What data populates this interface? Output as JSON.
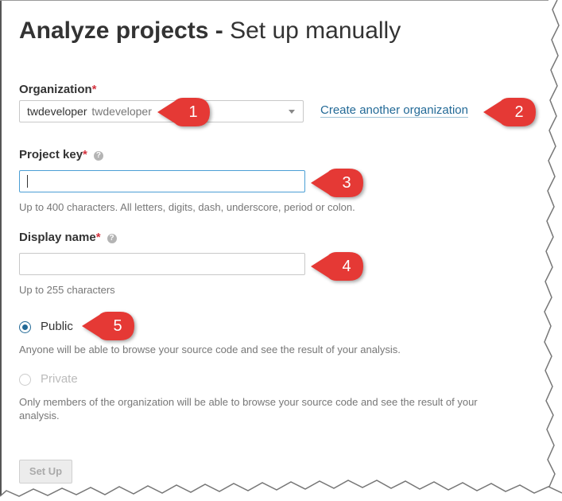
{
  "page": {
    "title_strong": "Analyze projects",
    "title_sep": " - ",
    "title_rest": "Set up manually"
  },
  "organization": {
    "label": "Organization",
    "required_mark": "*",
    "selected_key": "twdeveloper",
    "selected_name": "twdeveloper",
    "create_link": "Create another organization"
  },
  "project_key": {
    "label": "Project key",
    "required_mark": "*",
    "help_icon": "?",
    "value": "",
    "hint": "Up to 400 characters. All letters, digits, dash, underscore, period or colon."
  },
  "display_name": {
    "label": "Display name",
    "required_mark": "*",
    "help_icon": "?",
    "value": "",
    "hint": "Up to 255 characters"
  },
  "visibility": {
    "public_label": "Public",
    "public_desc": "Anyone will be able to browse your source code and see the result of your analysis.",
    "private_label": "Private",
    "private_desc_line1": "Only members of the organization will be able to browse your source code and see the result of your",
    "private_desc_line2": "analysis.",
    "selected": "public"
  },
  "actions": {
    "setup_label": "Set Up"
  },
  "callouts": [
    "1",
    "2",
    "3",
    "4",
    "5"
  ],
  "colors": {
    "accent": "#236a97",
    "required": "#d4333f",
    "callout": "#e53935",
    "focus": "#4b9fd5"
  }
}
